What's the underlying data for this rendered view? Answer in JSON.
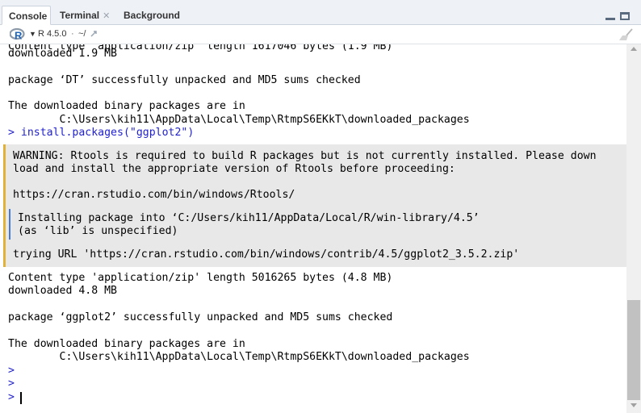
{
  "tabs": [
    {
      "label": "Console"
    },
    {
      "label": "Terminal"
    },
    {
      "label": "Background Jobs"
    }
  ],
  "toolbar": {
    "version": "R 4.5.0",
    "separator": "·",
    "path": "~/"
  },
  "console": {
    "lines": [
      "downloaded 1.9 MB",
      "package ‘DT’ successfully unpacked and MD5 sums checked",
      "The downloaded binary packages are in",
      "        C:\\Users\\kih11\\AppData\\Local\\Temp\\RtmpS6EKkT\\downloaded_packages",
      "Content type 'application/zip' length 5016265 bytes (4.8 MB)",
      "downloaded 4.8 MB",
      "package ‘ggplot2’ successfully unpacked and MD5 sums checked",
      "The downloaded binary packages are in",
      "        C:\\Users\\kih11\\AppData\\Local\\Temp\\RtmpS6EKkT\\downloaded_packages"
    ],
    "prompt_symbol": ">",
    "command": "install.packages(\"ggplot2\")",
    "warning": {
      "label": "WARNING:",
      "line1_rest": " Rtools is required to build R packages but is not currently installed. Please down",
      "line2": "load and install the appropriate version of Rtools before proceeding:",
      "url": "https://cran.rstudio.com/bin/windows/Rtools/",
      "install_line1": "Installing package into ‘C:/Users/kih11/AppData/Local/R/win-library/4.5’",
      "install_line2": "(as ‘lib’ is unspecified)",
      "trying_url": "trying URL 'https://cran.rstudio.com/bin/windows/contrib/4.5/ggplot2_3.5.2.zip'"
    }
  },
  "colors": {
    "command": "#2222cc",
    "warning_bg": "#e8e8e8",
    "warning_accent": "#e0b23a",
    "message_accent": "#4a7bd4"
  }
}
